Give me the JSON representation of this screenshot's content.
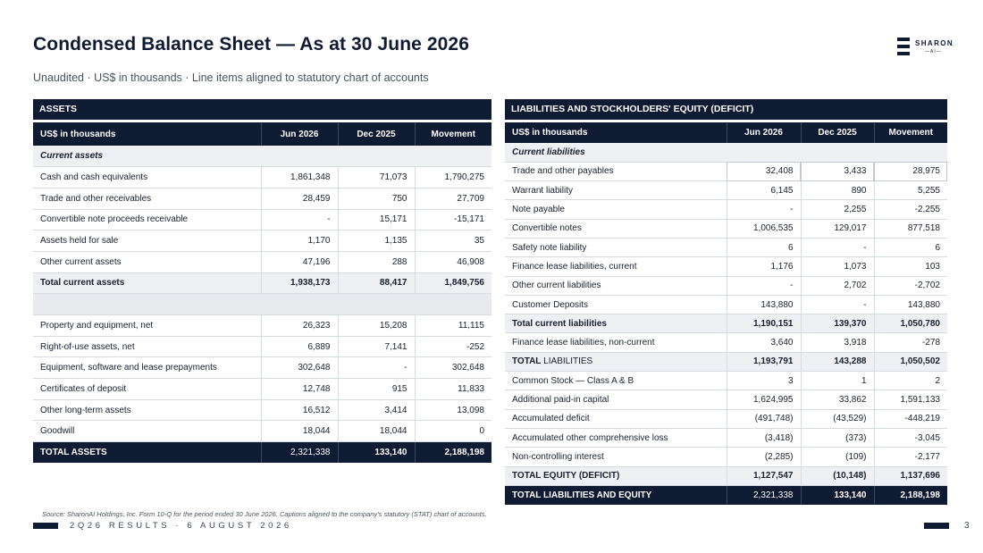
{
  "header": {
    "title": "Condensed Balance Sheet  —  As at 30 June 2026",
    "subtitle": "Unaudited  ·  US$ in thousands  ·  Line items aligned to statutory chart of accounts",
    "logo_text": "SHARON",
    "logo_sub": "—AI—"
  },
  "assets": {
    "section_title": "ASSETS",
    "columns": [
      "US$ in thousands",
      "Jun 2026",
      "Dec 2025",
      "Movement"
    ],
    "current_heading": "Current assets",
    "rows_current": [
      {
        "label": "Cash and cash equivalents",
        "jun": "1,861,348",
        "dec": "71,073",
        "mov": "1,790,275"
      },
      {
        "label": "Trade and other receivables",
        "jun": "28,459",
        "dec": "750",
        "mov": "27,709"
      },
      {
        "label": "Convertible note proceeds receivable",
        "jun": "-",
        "dec": "15,171",
        "mov": "-15,171"
      },
      {
        "label": "Assets held for sale",
        "jun": "1,170",
        "dec": "1,135",
        "mov": "35"
      },
      {
        "label": "Other current assets",
        "jun": "47,196",
        "dec": "288",
        "mov": "46,908"
      }
    ],
    "total_current": {
      "label": "Total current assets",
      "jun": "1,938,173",
      "dec": "88,417",
      "mov": "1,849,756"
    },
    "rows_noncurrent": [
      {
        "label": "Property and equipment, net",
        "jun": "26,323",
        "dec": "15,208",
        "mov": "11,115"
      },
      {
        "label": "Right-of-use assets, net",
        "jun": "6,889",
        "dec": "7,141",
        "mov": "-252"
      },
      {
        "label": "Equipment, software and lease prepayments",
        "jun": "302,648",
        "dec": "-",
        "mov": "302,648"
      },
      {
        "label": "Certificates of deposit",
        "jun": "12,748",
        "dec": "915",
        "mov": "11,833"
      },
      {
        "label": "Other long-term assets",
        "jun": "16,512",
        "dec": "3,414",
        "mov": "13,098"
      },
      {
        "label": "Goodwill",
        "jun": "18,044",
        "dec": "18,044",
        "mov": "0"
      }
    ],
    "total_assets": {
      "label": "TOTAL ASSETS",
      "jun": "2,321,338",
      "dec": "133,140",
      "mov": "2,188,198"
    }
  },
  "liabilities": {
    "section_title": "LIABILITIES AND STOCKHOLDERS' EQUITY (DEFICIT)",
    "columns": [
      "US$ in thousands",
      "Jun 2026",
      "Dec 2025",
      "Movement"
    ],
    "current_heading": "Current liabilities",
    "rows_current": [
      {
        "label": "Trade and other payables",
        "jun": "32,408",
        "dec": "3,433",
        "mov": "28,975"
      },
      {
        "label": "Warrant liability",
        "jun": "6,145",
        "dec": "890",
        "mov": "5,255"
      },
      {
        "label": "Note payable",
        "jun": "-",
        "dec": "2,255",
        "mov": "-2,255"
      },
      {
        "label": "Convertible notes",
        "jun": "1,006,535",
        "dec": "129,017",
        "mov": "877,518"
      },
      {
        "label": "Safety note liability",
        "jun": "6",
        "dec": "-",
        "mov": "6"
      },
      {
        "label": "Finance lease liabilities, current",
        "jun": "1,176",
        "dec": "1,073",
        "mov": "103"
      },
      {
        "label": "Other current liabilities",
        "jun": "-",
        "dec": "2,702",
        "mov": "-2,702"
      },
      {
        "label": "Customer Deposits",
        "jun": "143,880",
        "dec": "-",
        "mov": "143,880"
      }
    ],
    "total_current": {
      "label": "Total current liabilities",
      "jun": "1,190,151",
      "dec": "139,370",
      "mov": "1,050,780"
    },
    "row_noncurrent": {
      "label": "Finance lease liabilities, non-current",
      "jun": "3,640",
      "dec": "3,918",
      "mov": "-278"
    },
    "total_liabilities": {
      "label_a": "TOTAL",
      "label_b": " LIABILITIES",
      "jun": "1,193,791",
      "dec": "143,288",
      "mov": "1,050,502"
    },
    "rows_equity": [
      {
        "label": "Common Stock — Class A & B",
        "jun": "3",
        "dec": "1",
        "mov": "2"
      },
      {
        "label": "Additional paid-in capital",
        "jun": "1,624,995",
        "dec": "33,862",
        "mov": "1,591,133"
      },
      {
        "label": "Accumulated deficit",
        "jun": "(491,748)",
        "dec": "(43,529)",
        "mov": "-448,219"
      },
      {
        "label": "Accumulated other comprehensive loss",
        "jun": "(3,418)",
        "dec": "(373)",
        "mov": "-3,045"
      },
      {
        "label": "Non-controlling interest",
        "jun": "(2,285)",
        "dec": "(109)",
        "mov": "-2,177"
      }
    ],
    "total_equity": {
      "label": "TOTAL EQUITY (DEFICIT)",
      "jun": "1,127,547",
      "dec": "(10,148)",
      "mov": "1,137,696"
    },
    "total_liab_equity": {
      "label": "TOTAL LIABILITIES AND EQUITY",
      "jun": "2,321,338",
      "dec": "133,140",
      "mov": "2,188,198"
    }
  },
  "footer": {
    "source": "Source: SharonAI Holdings, Inc. Form 10-Q for the period ended 30 June 2026.  Captions aligned to the company's statutory (STAT) chart of accounts.",
    "event": "2Q26 RESULTS  ·  6 AUGUST 2026",
    "page": "3"
  }
}
